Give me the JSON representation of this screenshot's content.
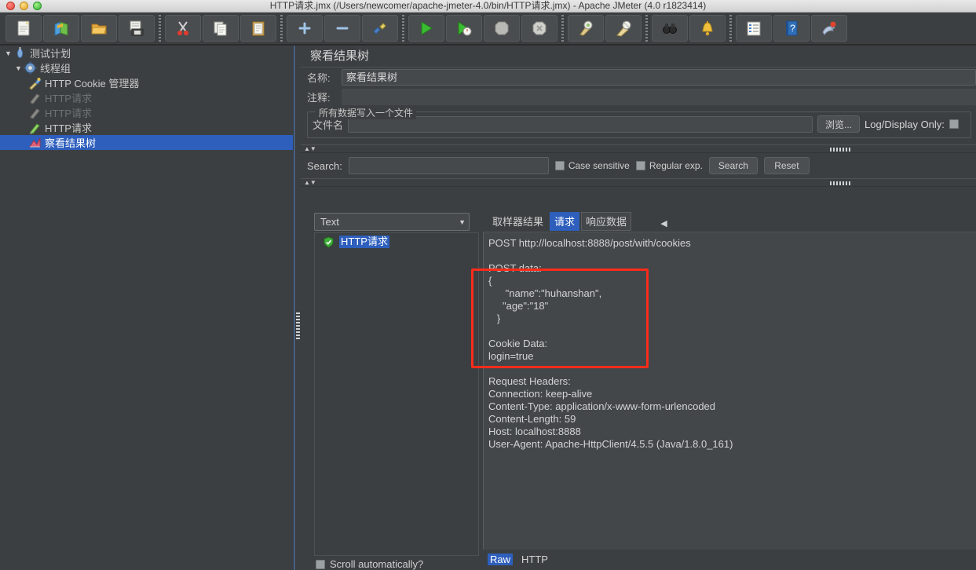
{
  "window": {
    "title": "HTTP请求.jmx (/Users/newcomer/apache-jmeter-4.0/bin/HTTP请求.jmx) - Apache JMeter (4.0 r1823414)"
  },
  "toolbar": {
    "buttons": [
      {
        "name": "new-button",
        "icon": "new-file-icon",
        "glyph": "🗒"
      },
      {
        "name": "templates-button",
        "icon": "templates-icon",
        "glyph": "📗"
      },
      {
        "name": "open-button",
        "icon": "open-folder-icon",
        "glyph": "📂"
      },
      {
        "name": "save-button",
        "icon": "save-disk-icon",
        "glyph": "💾"
      },
      {
        "name": "cut-button",
        "icon": "scissors-icon",
        "glyph": "✂"
      },
      {
        "name": "copy-button",
        "icon": "copy-icon",
        "glyph": "🗐"
      },
      {
        "name": "paste-button",
        "icon": "paste-clipboard-icon",
        "glyph": "📋"
      },
      {
        "name": "expand-button",
        "icon": "plus-icon",
        "glyph": "+"
      },
      {
        "name": "collapse-button",
        "icon": "minus-icon",
        "glyph": "−"
      },
      {
        "name": "toggle-button",
        "icon": "toggle-icon",
        "glyph": "✎"
      },
      {
        "name": "start-button",
        "icon": "play-icon",
        "glyph": "▶"
      },
      {
        "name": "start-no-pauses-button",
        "icon": "play-no-pause-icon",
        "glyph": "▶"
      },
      {
        "name": "stop-button",
        "icon": "stop-octagon-icon",
        "glyph": "⬢"
      },
      {
        "name": "shutdown-button",
        "icon": "shutdown-icon",
        "glyph": "⬣"
      },
      {
        "name": "clear-button",
        "icon": "broom-clear-icon",
        "glyph": "🧹"
      },
      {
        "name": "clear-all-button",
        "icon": "broom-clear-all-icon",
        "glyph": "🧹"
      },
      {
        "name": "search-button",
        "icon": "binoculars-icon",
        "glyph": "🔭"
      },
      {
        "name": "search-reset-button",
        "icon": "bell-reset-icon",
        "glyph": "🔔"
      },
      {
        "name": "function-helper-button",
        "icon": "function-helper-icon",
        "glyph": "📑"
      },
      {
        "name": "help-button",
        "icon": "help-book-icon",
        "glyph": "❓"
      },
      {
        "name": "undo-button",
        "icon": "undo-icon",
        "glyph": "🎨"
      }
    ]
  },
  "tree": {
    "items": [
      {
        "label": "测试计划",
        "icon": "test-plan-icon",
        "depth": 0,
        "twisty": "▼",
        "state": "normal"
      },
      {
        "label": "线程组",
        "icon": "thread-group-icon",
        "depth": 1,
        "twisty": "▼",
        "state": "normal"
      },
      {
        "label": "HTTP Cookie 管理器",
        "icon": "cookie-manager-icon",
        "depth": 2,
        "twisty": "",
        "state": "normal"
      },
      {
        "label": "HTTP请求",
        "icon": "http-request-icon",
        "depth": 2,
        "twisty": "",
        "state": "disabled"
      },
      {
        "label": "HTTP请求",
        "icon": "http-request-icon",
        "depth": 2,
        "twisty": "",
        "state": "disabled"
      },
      {
        "label": "HTTP请求",
        "icon": "http-request-icon",
        "depth": 2,
        "twisty": "",
        "state": "normal"
      },
      {
        "label": "察看结果树",
        "icon": "view-results-tree-icon",
        "depth": 2,
        "twisty": "",
        "state": "selected"
      }
    ]
  },
  "panel": {
    "title": "察看结果树",
    "name_label": "名称:",
    "name_value": "察看结果树",
    "comment_label": "注释:",
    "comment_value": "",
    "file_group_legend": "所有数据写入一个文件",
    "filename_label": "文件名",
    "filename_value": "",
    "browse_button": "浏览...",
    "log_display_only_label": "Log/Display Only:"
  },
  "search": {
    "label": "Search:",
    "value": "",
    "case_sensitive_label": "Case sensitive",
    "regular_exp_label": "Regular exp.",
    "search_button": "Search",
    "reset_button": "Reset"
  },
  "results": {
    "filter_selected": "Text",
    "sampler_items": [
      {
        "label": "HTTP请求",
        "icon": "green-shield-success-icon",
        "selected": true
      }
    ],
    "scroll_automatically_label": "Scroll automatically?",
    "tabs": [
      {
        "label": "取样器结果",
        "active": false
      },
      {
        "label": "请求",
        "active": true
      },
      {
        "label": "响应数据",
        "active": false
      }
    ],
    "view_modes": [
      {
        "label": "Raw",
        "active": true
      },
      {
        "label": "HTTP",
        "active": false
      }
    ],
    "request_text": "POST http://localhost:8888/post/with/cookies\n\nPOST data:\n{\n      \"name\":\"huhanshan\",\n     \"age\":\"18\"\n   }\n\nCookie Data:\nlogin=true\n\nRequest Headers:\nConnection: keep-alive\nContent-Type: application/x-www-form-urlencoded\nContent-Length: 59\nHost: localhost:8888\nUser-Agent: Apache-HttpClient/4.5.5 (Java/1.8.0_161)\n"
  },
  "annotation": {
    "highlight_color": "#fb2c1b"
  }
}
